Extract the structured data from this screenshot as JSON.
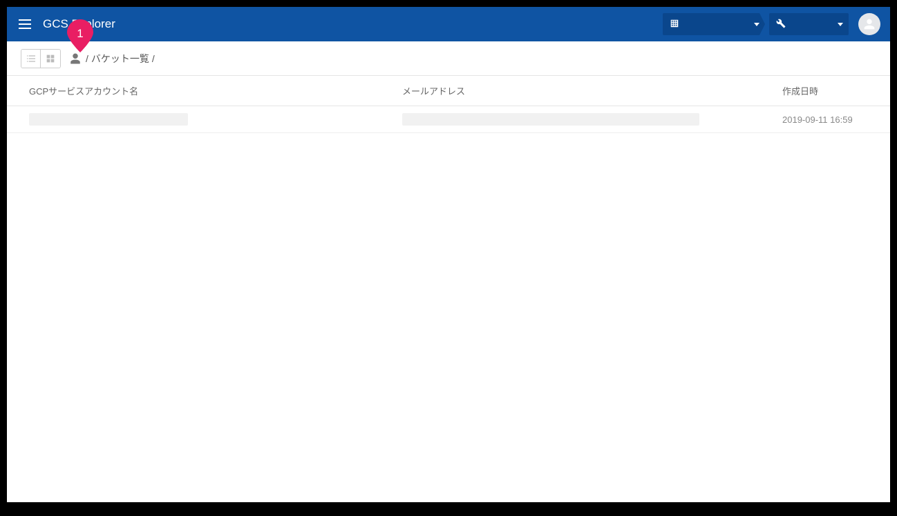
{
  "header": {
    "app_title": "GCS Explorer"
  },
  "annotation": {
    "pin_number": "1"
  },
  "breadcrumb": {
    "label": "バケット一覧"
  },
  "table": {
    "headers": {
      "name": "GCPサービスアカウント名",
      "email": "メールアドレス",
      "created": "作成日時"
    },
    "rows": [
      {
        "created": "2019-09-11 16:59"
      }
    ]
  }
}
